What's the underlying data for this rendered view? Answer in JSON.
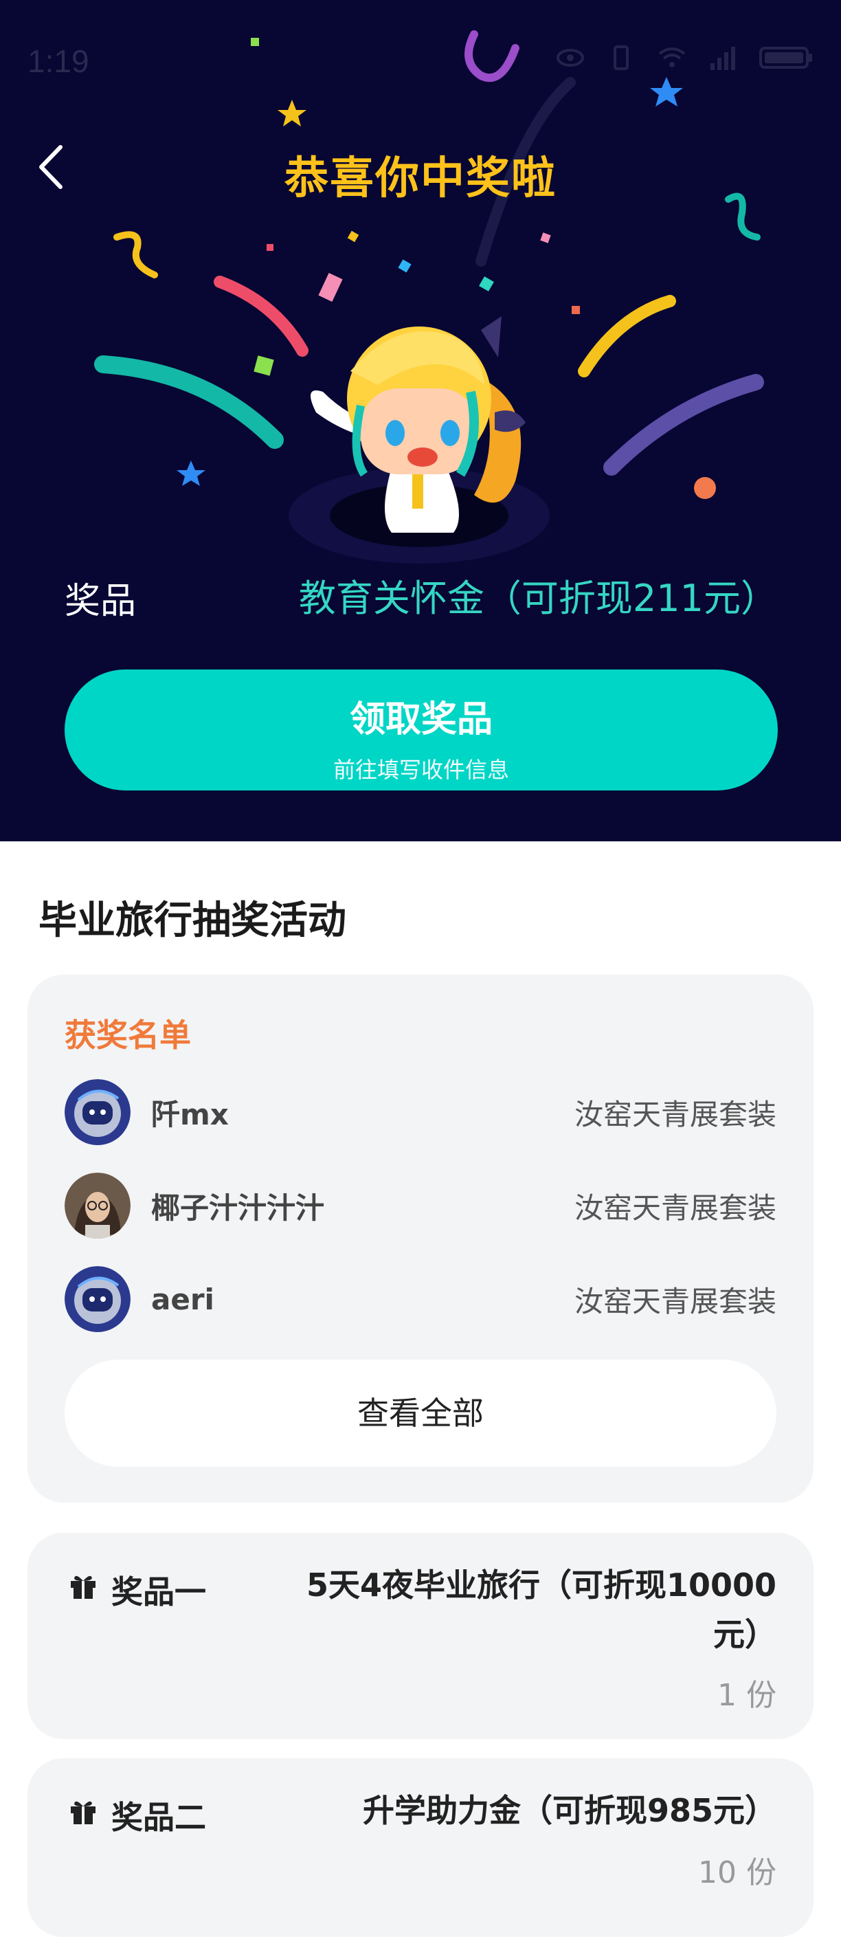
{
  "status_bar": {
    "time": "1:19"
  },
  "header": {
    "title": "恭喜你中奖啦"
  },
  "prize": {
    "label": "奖品",
    "value": "教育关怀金（可折现211元）"
  },
  "claim_button": {
    "main": "领取奖品",
    "sub": "前往填写收件信息"
  },
  "activity": {
    "title": "毕业旅行抽奖活动"
  },
  "winners": {
    "heading": "获奖名单",
    "rows": [
      {
        "name": "阡mx",
        "prize": "汝窑天青展套装",
        "avatar": "robot-avatar"
      },
      {
        "name": "椰子汁汁汁汁",
        "prize": "汝窑天青展套装",
        "avatar": "photo-avatar"
      },
      {
        "name": "aeri",
        "prize": "汝窑天青展套装",
        "avatar": "robot-avatar"
      }
    ],
    "view_all": "查看全部"
  },
  "prizes": [
    {
      "label": "奖品一",
      "name_line1": "5天4夜毕业旅行（可折现10000",
      "name_line2": "元）",
      "quantity": "1 份"
    },
    {
      "label": "奖品二",
      "name_line1": "升学助力金（可折现985元）",
      "quantity": "10 份"
    }
  ],
  "colors": {
    "hero_bg": "#080633",
    "title": "#ffc21a",
    "accent": "#00d6c6",
    "winners_heading": "#f07a3a"
  }
}
